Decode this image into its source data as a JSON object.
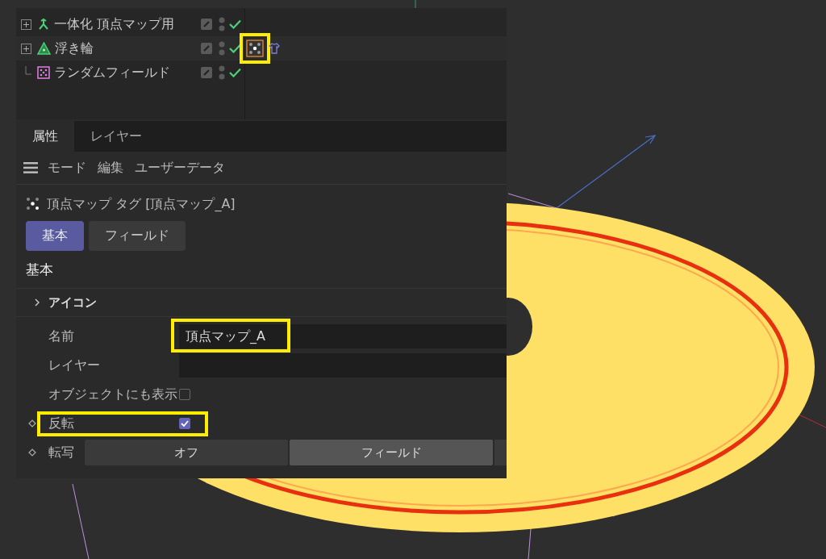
{
  "objects": [
    {
      "name": "一体化 頂点マップ用",
      "kind": "connect",
      "expanded": false,
      "enabled": true
    },
    {
      "name": "浮き輪",
      "kind": "polygon",
      "expanded": false,
      "enabled": true,
      "tags": [
        {
          "kind": "vertex_map",
          "highlighted": true
        },
        {
          "kind": "shirt",
          "highlighted": false
        }
      ]
    },
    {
      "name": "ランダムフィールド",
      "kind": "random",
      "enabled": true
    }
  ],
  "tabs": [
    {
      "label": "属性",
      "selected": true
    },
    {
      "label": "レイヤー",
      "selected": false
    }
  ],
  "menu": [
    "モード",
    "編集",
    "ユーザーデータ"
  ],
  "header": {
    "title": "頂点マップ タグ [頂点マップ_A]"
  },
  "pages": [
    {
      "label": "基本",
      "selected": true
    },
    {
      "label": "フィールド",
      "selected": false
    }
  ],
  "section": "基本",
  "group": {
    "label": "アイコン",
    "expanded": false
  },
  "properties": [
    {
      "kind": "text",
      "label": "名前",
      "value": "頂点マップ_A",
      "highlighted": true,
      "animatable": false
    },
    {
      "kind": "text",
      "label": "レイヤー",
      "highlighted": false,
      "animatable": false
    },
    {
      "kind": "checkbox",
      "label": "オブジェクトにも表示",
      "checked": false,
      "highlighted": false,
      "animatable": false
    },
    {
      "kind": "checkbox",
      "label": "反転",
      "checked": true,
      "highlighted": true,
      "animatable": true
    },
    {
      "kind": "segmented",
      "label": "転写",
      "animatable": true,
      "highlighted": false,
      "options": [
        {
          "label": "オフ",
          "selected": false
        },
        {
          "label": "フィールド",
          "selected": true
        }
      ]
    }
  ]
}
